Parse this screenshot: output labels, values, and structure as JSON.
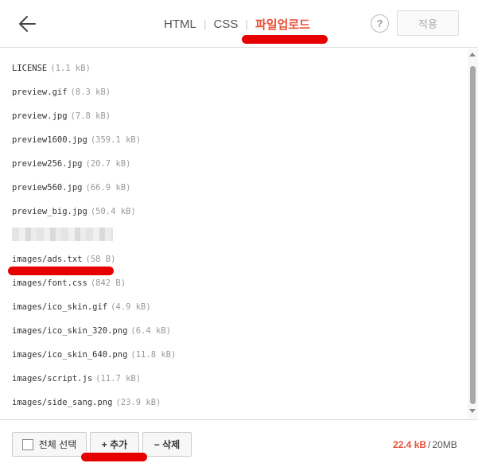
{
  "header": {
    "tabs": [
      {
        "label": "HTML"
      },
      {
        "label": "CSS"
      },
      {
        "label": "파일업로드"
      }
    ],
    "help_label": "?",
    "apply_label": "적용"
  },
  "files": [
    {
      "name": "LICENSE",
      "size": "(1.1 kB)"
    },
    {
      "name": "preview.gif",
      "size": "(8.3 kB)"
    },
    {
      "name": "preview.jpg",
      "size": "(7.8 kB)"
    },
    {
      "name": "preview1600.jpg",
      "size": "(359.1 kB)"
    },
    {
      "name": "preview256.jpg",
      "size": "(20.7 kB)"
    },
    {
      "name": "preview560.jpg",
      "size": "(66.9 kB)"
    },
    {
      "name": "preview_big.jpg",
      "size": "(50.4 kB)"
    },
    {
      "name": "images/ads.txt",
      "size": "(58 B)"
    },
    {
      "name": "images/font.css",
      "size": "(842 B)"
    },
    {
      "name": "images/ico_skin.gif",
      "size": "(4.9 kB)"
    },
    {
      "name": "images/ico_skin_320.png",
      "size": "(6.4 kB)"
    },
    {
      "name": "images/ico_skin_640.png",
      "size": "(11.8 kB)"
    },
    {
      "name": "images/script.js",
      "size": "(11.7 kB)"
    },
    {
      "name": "images/side_sang.png",
      "size": "(23.9 kB)"
    }
  ],
  "footer": {
    "select_all_label": "전체 선택",
    "add_label": "+ 추가",
    "delete_label": "− 삭제",
    "quota_used": "22.4 kB",
    "quota_sep": "/",
    "quota_total": "20MB"
  },
  "colors": {
    "accent": "#e8513a",
    "annotation": "#e60000"
  },
  "icons": {
    "back": "arrow-left-icon",
    "help": "question-icon",
    "checkbox": "checkbox-icon"
  }
}
